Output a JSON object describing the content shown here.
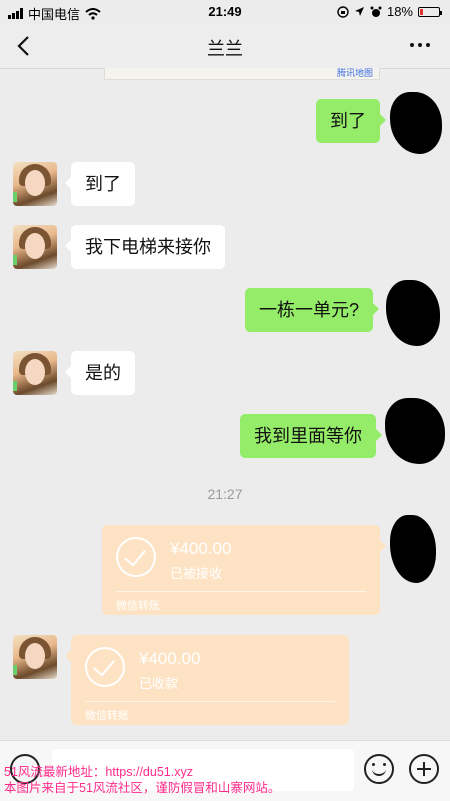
{
  "status_bar": {
    "carrier": "中国电信",
    "time": "21:49",
    "battery": "18%",
    "battery_level": 0.18
  },
  "nav": {
    "title": "兰兰"
  },
  "map_strip": {
    "label": "腾讯地图"
  },
  "messages": [
    {
      "side": "right",
      "text": "到了"
    },
    {
      "side": "left",
      "text": "到了"
    },
    {
      "side": "left",
      "text": "我下电梯来接你"
    },
    {
      "side": "right",
      "text": "一栋一单元?"
    },
    {
      "side": "left",
      "text": "是的"
    },
    {
      "side": "right",
      "text": "我到里面等你"
    }
  ],
  "timestamp": "21:27",
  "transfers": [
    {
      "side": "right",
      "amount": "¥400.00",
      "status": "已被接收",
      "footer": "微信转账"
    },
    {
      "side": "left",
      "amount": "¥400.00",
      "status": "已收款",
      "footer": "微信转账"
    }
  ],
  "watermark": {
    "line1": "51风流最新地址：https://du51.xyz",
    "line2": "本图片来自于51风流社区，谨防假冒和山寨网站。"
  },
  "colors": {
    "outgoing_bubble": "#95ec69",
    "incoming_bubble": "#ffffff",
    "transfer_card": "#fde3c4",
    "watermark": "#ff2a8a"
  }
}
